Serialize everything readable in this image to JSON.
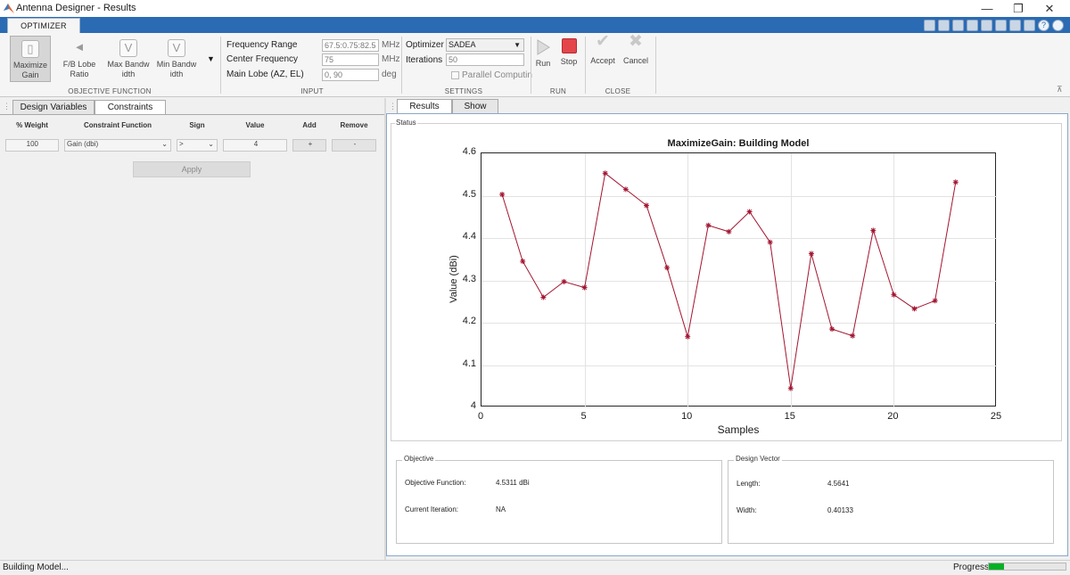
{
  "window": {
    "title": "Antenna Designer - Results",
    "controls": [
      "—",
      "❐",
      "✕"
    ]
  },
  "ribbon": {
    "tab": "OPTIMIZER",
    "objective": {
      "buttons": [
        {
          "line1": "Maximize",
          "line2": "Gain"
        },
        {
          "line1": "F/B Lobe",
          "line2": "Ratio"
        },
        {
          "line1": "Max Bandw",
          "line2": "idth"
        },
        {
          "line1": "Min Bandw",
          "line2": "idth"
        }
      ],
      "section": "OBJECTIVE FUNCTION"
    },
    "input": {
      "freq_range_label": "Frequency Range",
      "freq_range_value": "67.5:0.75:82.5",
      "freq_range_unit": "MHz",
      "center_freq_label": "Center Frequency",
      "center_freq_value": "75",
      "center_freq_unit": "MHz",
      "main_lobe_label": "Main Lobe (AZ, EL)",
      "main_lobe_value": "0, 90",
      "main_lobe_unit": "deg",
      "section": "INPUT"
    },
    "settings": {
      "optimizer_label": "Optimizer",
      "optimizer_value": "SADEA",
      "iterations_label": "Iterations",
      "iterations_value": "50",
      "parallel_label": "Parallel Computin",
      "section": "SETTINGS"
    },
    "run": {
      "run_label": "Run",
      "stop_label": "Stop",
      "section": "RUN"
    },
    "close": {
      "accept_label": "Accept",
      "cancel_label": "Cancel",
      "section": "CLOSE"
    }
  },
  "left_panel": {
    "tabs": [
      "Design Variables",
      "Constraints"
    ],
    "columns": [
      "% Weight",
      "Constraint Function",
      "Sign",
      "Value",
      "Add",
      "Remove"
    ],
    "row": {
      "weight": "100",
      "function": "Gain (dbi)",
      "sign": ">",
      "value": "4",
      "add": "+",
      "remove": "-"
    },
    "apply_label": "Apply"
  },
  "right_panel": {
    "tabs": [
      "Results",
      "Show"
    ],
    "status_label": "Status",
    "objective": {
      "title": "Objective",
      "function_label": "Objective Function:",
      "function_value": "4.5311 dBi",
      "iteration_label": "Current Iteration:",
      "iteration_value": "NA"
    },
    "design_vector": {
      "title": "Design Vector",
      "length_label": "Length:",
      "length_value": "4.5641",
      "width_label": "Width:",
      "width_value": "0.40133"
    }
  },
  "chart_data": {
    "type": "line",
    "title": "MaximizeGain: Building Model",
    "xlabel": "Samples",
    "ylabel": "Value (dBi)",
    "xlim": [
      0,
      25
    ],
    "ylim": [
      4,
      4.6
    ],
    "xticks": [
      0,
      5,
      10,
      15,
      20,
      25
    ],
    "yticks": [
      4,
      4.1,
      4.2,
      4.3,
      4.4,
      4.5,
      4.6
    ],
    "grid": true,
    "color": "#a2142f",
    "x": [
      1,
      2,
      3,
      4,
      5,
      6,
      7,
      8,
      9,
      10,
      11,
      12,
      13,
      14,
      15,
      16,
      17,
      18,
      19,
      20,
      21,
      22,
      23
    ],
    "y": [
      4.503,
      4.345,
      4.26,
      4.297,
      4.283,
      4.553,
      4.515,
      4.477,
      4.33,
      4.167,
      4.43,
      4.415,
      4.462,
      4.39,
      4.045,
      4.363,
      4.185,
      4.169,
      4.418,
      4.266,
      4.233,
      4.252,
      4.532
    ]
  },
  "statusbar": {
    "message": "Building Model...",
    "progress_label": "Progress",
    "progress_fraction": 0.2
  }
}
